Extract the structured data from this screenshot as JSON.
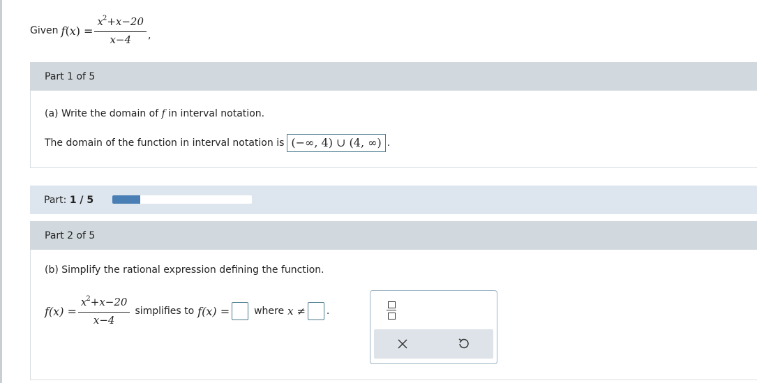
{
  "given": {
    "label": "Given",
    "fname": "f",
    "var": "x",
    "numerator_base": "x",
    "numerator_exp": "2",
    "numerator_rest": "+x−20",
    "denominator": "x−4",
    "trailing": ","
  },
  "part1": {
    "header": "Part 1 of 5",
    "question": "(a) Write the domain of",
    "question_f": "f",
    "question_end": "in interval notation.",
    "answer_lead": "The domain of the function in interval notation is",
    "answer_value": "(−∞, 4) ∪ (4, ∞)",
    "answer_end": "."
  },
  "progress": {
    "label": "Part:",
    "value": "1 / 5",
    "fraction": 0.2,
    "fill_color": "#4a7fb5"
  },
  "part2": {
    "header": "Part 2 of 5",
    "question": "(b) Simplify the rational expression defining the function.",
    "lhs": "f(x) =",
    "simplifies_to": "simplifies to",
    "rhs_f": "f(x) =",
    "where": "where",
    "neq": "x ≠",
    "end": "."
  },
  "palette": {
    "fraction_icon": "fraction-template-icon",
    "clear_icon": "close-icon",
    "undo_icon": "undo-icon"
  }
}
